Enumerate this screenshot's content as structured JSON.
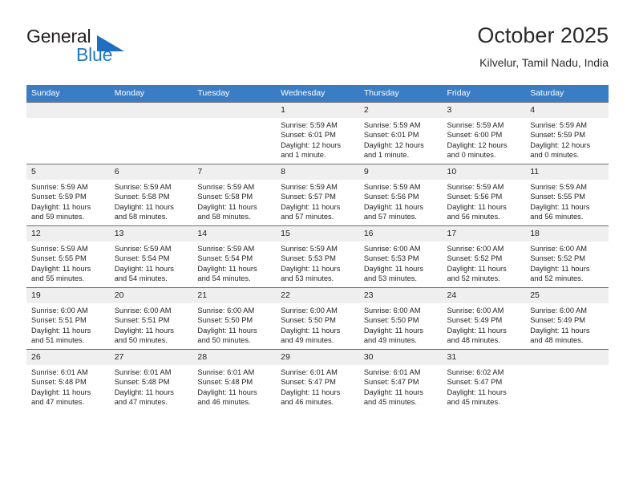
{
  "brand": {
    "name_part1": "General",
    "name_part2": "Blue",
    "logo_icon": "blue-triangle",
    "color_primary": "#1f7ac6",
    "color_text": "#231f20"
  },
  "header": {
    "month_title": "October 2025",
    "location": "Kilvelur, Tamil Nadu, India"
  },
  "calendar": {
    "header_bg": "#3b7dc4",
    "header_text_color": "#ffffff",
    "daynum_bg": "#efeff0",
    "weekdays": [
      "Sunday",
      "Monday",
      "Tuesday",
      "Wednesday",
      "Thursday",
      "Friday",
      "Saturday"
    ],
    "weeks": [
      [
        {
          "day": "",
          "empty": true
        },
        {
          "day": "",
          "empty": true
        },
        {
          "day": "",
          "empty": true
        },
        {
          "day": "1",
          "sunrise": "Sunrise: 5:59 AM",
          "sunset": "Sunset: 6:01 PM",
          "daylight_line1": "Daylight: 12 hours",
          "daylight_line2": "and 1 minute."
        },
        {
          "day": "2",
          "sunrise": "Sunrise: 5:59 AM",
          "sunset": "Sunset: 6:01 PM",
          "daylight_line1": "Daylight: 12 hours",
          "daylight_line2": "and 1 minute."
        },
        {
          "day": "3",
          "sunrise": "Sunrise: 5:59 AM",
          "sunset": "Sunset: 6:00 PM",
          "daylight_line1": "Daylight: 12 hours",
          "daylight_line2": "and 0 minutes."
        },
        {
          "day": "4",
          "sunrise": "Sunrise: 5:59 AM",
          "sunset": "Sunset: 5:59 PM",
          "daylight_line1": "Daylight: 12 hours",
          "daylight_line2": "and 0 minutes."
        }
      ],
      [
        {
          "day": "5",
          "sunrise": "Sunrise: 5:59 AM",
          "sunset": "Sunset: 5:59 PM",
          "daylight_line1": "Daylight: 11 hours",
          "daylight_line2": "and 59 minutes."
        },
        {
          "day": "6",
          "sunrise": "Sunrise: 5:59 AM",
          "sunset": "Sunset: 5:58 PM",
          "daylight_line1": "Daylight: 11 hours",
          "daylight_line2": "and 58 minutes."
        },
        {
          "day": "7",
          "sunrise": "Sunrise: 5:59 AM",
          "sunset": "Sunset: 5:58 PM",
          "daylight_line1": "Daylight: 11 hours",
          "daylight_line2": "and 58 minutes."
        },
        {
          "day": "8",
          "sunrise": "Sunrise: 5:59 AM",
          "sunset": "Sunset: 5:57 PM",
          "daylight_line1": "Daylight: 11 hours",
          "daylight_line2": "and 57 minutes."
        },
        {
          "day": "9",
          "sunrise": "Sunrise: 5:59 AM",
          "sunset": "Sunset: 5:56 PM",
          "daylight_line1": "Daylight: 11 hours",
          "daylight_line2": "and 57 minutes."
        },
        {
          "day": "10",
          "sunrise": "Sunrise: 5:59 AM",
          "sunset": "Sunset: 5:56 PM",
          "daylight_line1": "Daylight: 11 hours",
          "daylight_line2": "and 56 minutes."
        },
        {
          "day": "11",
          "sunrise": "Sunrise: 5:59 AM",
          "sunset": "Sunset: 5:55 PM",
          "daylight_line1": "Daylight: 11 hours",
          "daylight_line2": "and 56 minutes."
        }
      ],
      [
        {
          "day": "12",
          "sunrise": "Sunrise: 5:59 AM",
          "sunset": "Sunset: 5:55 PM",
          "daylight_line1": "Daylight: 11 hours",
          "daylight_line2": "and 55 minutes."
        },
        {
          "day": "13",
          "sunrise": "Sunrise: 5:59 AM",
          "sunset": "Sunset: 5:54 PM",
          "daylight_line1": "Daylight: 11 hours",
          "daylight_line2": "and 54 minutes."
        },
        {
          "day": "14",
          "sunrise": "Sunrise: 5:59 AM",
          "sunset": "Sunset: 5:54 PM",
          "daylight_line1": "Daylight: 11 hours",
          "daylight_line2": "and 54 minutes."
        },
        {
          "day": "15",
          "sunrise": "Sunrise: 5:59 AM",
          "sunset": "Sunset: 5:53 PM",
          "daylight_line1": "Daylight: 11 hours",
          "daylight_line2": "and 53 minutes."
        },
        {
          "day": "16",
          "sunrise": "Sunrise: 6:00 AM",
          "sunset": "Sunset: 5:53 PM",
          "daylight_line1": "Daylight: 11 hours",
          "daylight_line2": "and 53 minutes."
        },
        {
          "day": "17",
          "sunrise": "Sunrise: 6:00 AM",
          "sunset": "Sunset: 5:52 PM",
          "daylight_line1": "Daylight: 11 hours",
          "daylight_line2": "and 52 minutes."
        },
        {
          "day": "18",
          "sunrise": "Sunrise: 6:00 AM",
          "sunset": "Sunset: 5:52 PM",
          "daylight_line1": "Daylight: 11 hours",
          "daylight_line2": "and 52 minutes."
        }
      ],
      [
        {
          "day": "19",
          "sunrise": "Sunrise: 6:00 AM",
          "sunset": "Sunset: 5:51 PM",
          "daylight_line1": "Daylight: 11 hours",
          "daylight_line2": "and 51 minutes."
        },
        {
          "day": "20",
          "sunrise": "Sunrise: 6:00 AM",
          "sunset": "Sunset: 5:51 PM",
          "daylight_line1": "Daylight: 11 hours",
          "daylight_line2": "and 50 minutes."
        },
        {
          "day": "21",
          "sunrise": "Sunrise: 6:00 AM",
          "sunset": "Sunset: 5:50 PM",
          "daylight_line1": "Daylight: 11 hours",
          "daylight_line2": "and 50 minutes."
        },
        {
          "day": "22",
          "sunrise": "Sunrise: 6:00 AM",
          "sunset": "Sunset: 5:50 PM",
          "daylight_line1": "Daylight: 11 hours",
          "daylight_line2": "and 49 minutes."
        },
        {
          "day": "23",
          "sunrise": "Sunrise: 6:00 AM",
          "sunset": "Sunset: 5:50 PM",
          "daylight_line1": "Daylight: 11 hours",
          "daylight_line2": "and 49 minutes."
        },
        {
          "day": "24",
          "sunrise": "Sunrise: 6:00 AM",
          "sunset": "Sunset: 5:49 PM",
          "daylight_line1": "Daylight: 11 hours",
          "daylight_line2": "and 48 minutes."
        },
        {
          "day": "25",
          "sunrise": "Sunrise: 6:00 AM",
          "sunset": "Sunset: 5:49 PM",
          "daylight_line1": "Daylight: 11 hours",
          "daylight_line2": "and 48 minutes."
        }
      ],
      [
        {
          "day": "26",
          "sunrise": "Sunrise: 6:01 AM",
          "sunset": "Sunset: 5:48 PM",
          "daylight_line1": "Daylight: 11 hours",
          "daylight_line2": "and 47 minutes."
        },
        {
          "day": "27",
          "sunrise": "Sunrise: 6:01 AM",
          "sunset": "Sunset: 5:48 PM",
          "daylight_line1": "Daylight: 11 hours",
          "daylight_line2": "and 47 minutes."
        },
        {
          "day": "28",
          "sunrise": "Sunrise: 6:01 AM",
          "sunset": "Sunset: 5:48 PM",
          "daylight_line1": "Daylight: 11 hours",
          "daylight_line2": "and 46 minutes."
        },
        {
          "day": "29",
          "sunrise": "Sunrise: 6:01 AM",
          "sunset": "Sunset: 5:47 PM",
          "daylight_line1": "Daylight: 11 hours",
          "daylight_line2": "and 46 minutes."
        },
        {
          "day": "30",
          "sunrise": "Sunrise: 6:01 AM",
          "sunset": "Sunset: 5:47 PM",
          "daylight_line1": "Daylight: 11 hours",
          "daylight_line2": "and 45 minutes."
        },
        {
          "day": "31",
          "sunrise": "Sunrise: 6:02 AM",
          "sunset": "Sunset: 5:47 PM",
          "daylight_line1": "Daylight: 11 hours",
          "daylight_line2": "and 45 minutes."
        },
        {
          "day": "",
          "empty": true
        }
      ]
    ]
  }
}
